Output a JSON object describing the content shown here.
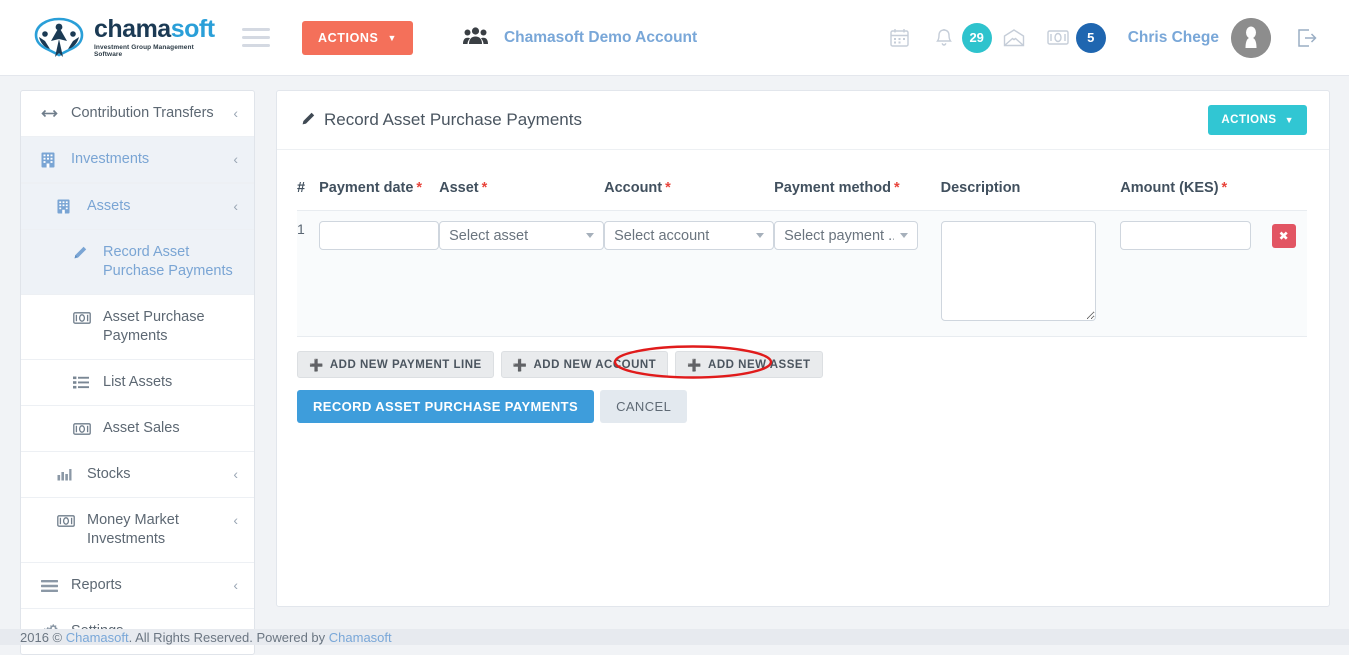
{
  "header": {
    "logo": {
      "word_a": "chama",
      "word_b": "soft",
      "tagline": "Investment Group Management Software"
    },
    "menu_toggle_icon": "hamburger-icon",
    "actions_label": "ACTIONS",
    "account_icon": "group-users-icon",
    "account_name": "Chamasoft Demo Account",
    "nav_icons": [
      {
        "name": "calendar-icon",
        "glyph": "Ὄ5"
      },
      {
        "name": "bell-icon",
        "glyph": "bell"
      },
      {
        "name": "envelope-icon",
        "glyph": "envelope"
      },
      {
        "name": "money-icon",
        "glyph": "money"
      }
    ],
    "notifications_count": "29",
    "payments_count": "5",
    "user_name": "Chris Chege",
    "avatar_icon": "user-avatar",
    "logout_icon": "logout-icon"
  },
  "sidebar": {
    "items": [
      {
        "label": "Contribution Transfers",
        "icon": "arrows-horizontal-icon",
        "level": 1,
        "active": false,
        "chevron": "‹"
      },
      {
        "label": "Investments",
        "icon": "building-icon",
        "level": 1,
        "active": true,
        "chevron": "‹"
      },
      {
        "label": "Assets",
        "icon": "building-icon",
        "level": 2,
        "active": true,
        "chevron": "‹"
      },
      {
        "label": "Record Asset Purchase Payments",
        "icon": "pencil-icon",
        "level": 3,
        "active": true,
        "chevron": ""
      },
      {
        "label": "Asset Purchase Payments",
        "icon": "money-icon",
        "level": 3,
        "active": false,
        "chevron": ""
      },
      {
        "label": "List Assets",
        "icon": "list-icon",
        "level": 3,
        "active": false,
        "chevron": ""
      },
      {
        "label": "Asset Sales",
        "icon": "money-icon",
        "level": 3,
        "active": false,
        "chevron": ""
      },
      {
        "label": "Stocks",
        "icon": "bar-chart-icon",
        "level": 2,
        "active": false,
        "chevron": "‹"
      },
      {
        "label": "Money Market Investments",
        "icon": "money-icon",
        "level": 2,
        "active": false,
        "chevron": "‹"
      },
      {
        "label": "Reports",
        "icon": "bars-icon",
        "level": 1,
        "active": false,
        "chevron": "‹"
      },
      {
        "label": "Settings",
        "icon": "gears-icon",
        "level": 1,
        "active": false,
        "chevron": "‹"
      }
    ]
  },
  "panel": {
    "title": "Record Asset Purchase Payments",
    "title_icon": "pencil-icon",
    "actions_label": "ACTIONS",
    "columns": [
      {
        "label": "#",
        "required": false
      },
      {
        "label": "Payment date",
        "required": true
      },
      {
        "label": "Asset",
        "required": true
      },
      {
        "label": "Account",
        "required": true
      },
      {
        "label": "Payment method",
        "required": true
      },
      {
        "label": "Description",
        "required": false
      },
      {
        "label": "Amount (KES)",
        "required": true
      }
    ],
    "rows": [
      {
        "index": "1",
        "payment_date": "",
        "payment_date_placeholder": "",
        "asset": "Select asset",
        "account": "Select account",
        "payment_method": "Select payment ...",
        "description": "",
        "amount": "",
        "delete_icon": "✖"
      }
    ],
    "add_buttons": [
      {
        "label": "ADD NEW PAYMENT LINE",
        "icon": "plus-icon",
        "highlighted": false
      },
      {
        "label": "ADD NEW ACCOUNT",
        "icon": "plus-icon",
        "highlighted": false
      },
      {
        "label": "ADD NEW ASSET",
        "icon": "plus-icon",
        "highlighted": true
      }
    ],
    "submit_label": "RECORD ASSET PURCHASE PAYMENTS",
    "cancel_label": "CANCEL"
  },
  "annotation": {
    "shape": "ellipse",
    "color": "#e01b1b",
    "target": "ADD NEW ASSET"
  },
  "footer": {
    "text_before": "2016 © ",
    "link1": "Chamasoft",
    "text_middle": ". All Rights Reserved. Powered by ",
    "link2": "Chamasoft"
  },
  "colors": {
    "orange": "#f4705a",
    "teal": "#31c6d3",
    "blue": "#3e9ddb",
    "link_blue": "#79a7d8",
    "red": "#e25563",
    "required": "#e8453c",
    "badge_teal": "#2ec3cd",
    "badge_blue": "#1f66b0"
  }
}
